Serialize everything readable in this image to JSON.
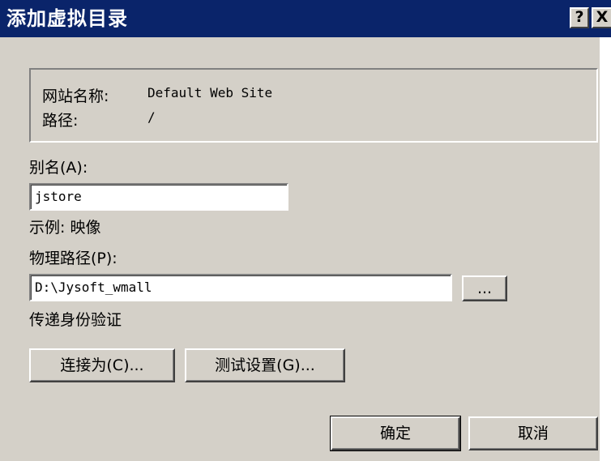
{
  "window": {
    "title": "添加虚拟目录",
    "help_label": "?",
    "close_label": "X"
  },
  "site_info": {
    "site_name_label": "网站名称:",
    "site_name_value": "Default Web Site",
    "path_label": "路径:",
    "path_value": "/"
  },
  "alias": {
    "label": "别名(A):",
    "value": "jstore",
    "example": "示例: 映像"
  },
  "physical_path": {
    "label": "物理路径(P):",
    "value": "D:\\Jysoft_wmall",
    "browse_label": "..."
  },
  "auth": {
    "label": "传递身份验证",
    "connect_as_label": "连接为(C)...",
    "test_settings_label": "测试设置(G)..."
  },
  "actions": {
    "ok_label": "确定",
    "cancel_label": "取消"
  }
}
